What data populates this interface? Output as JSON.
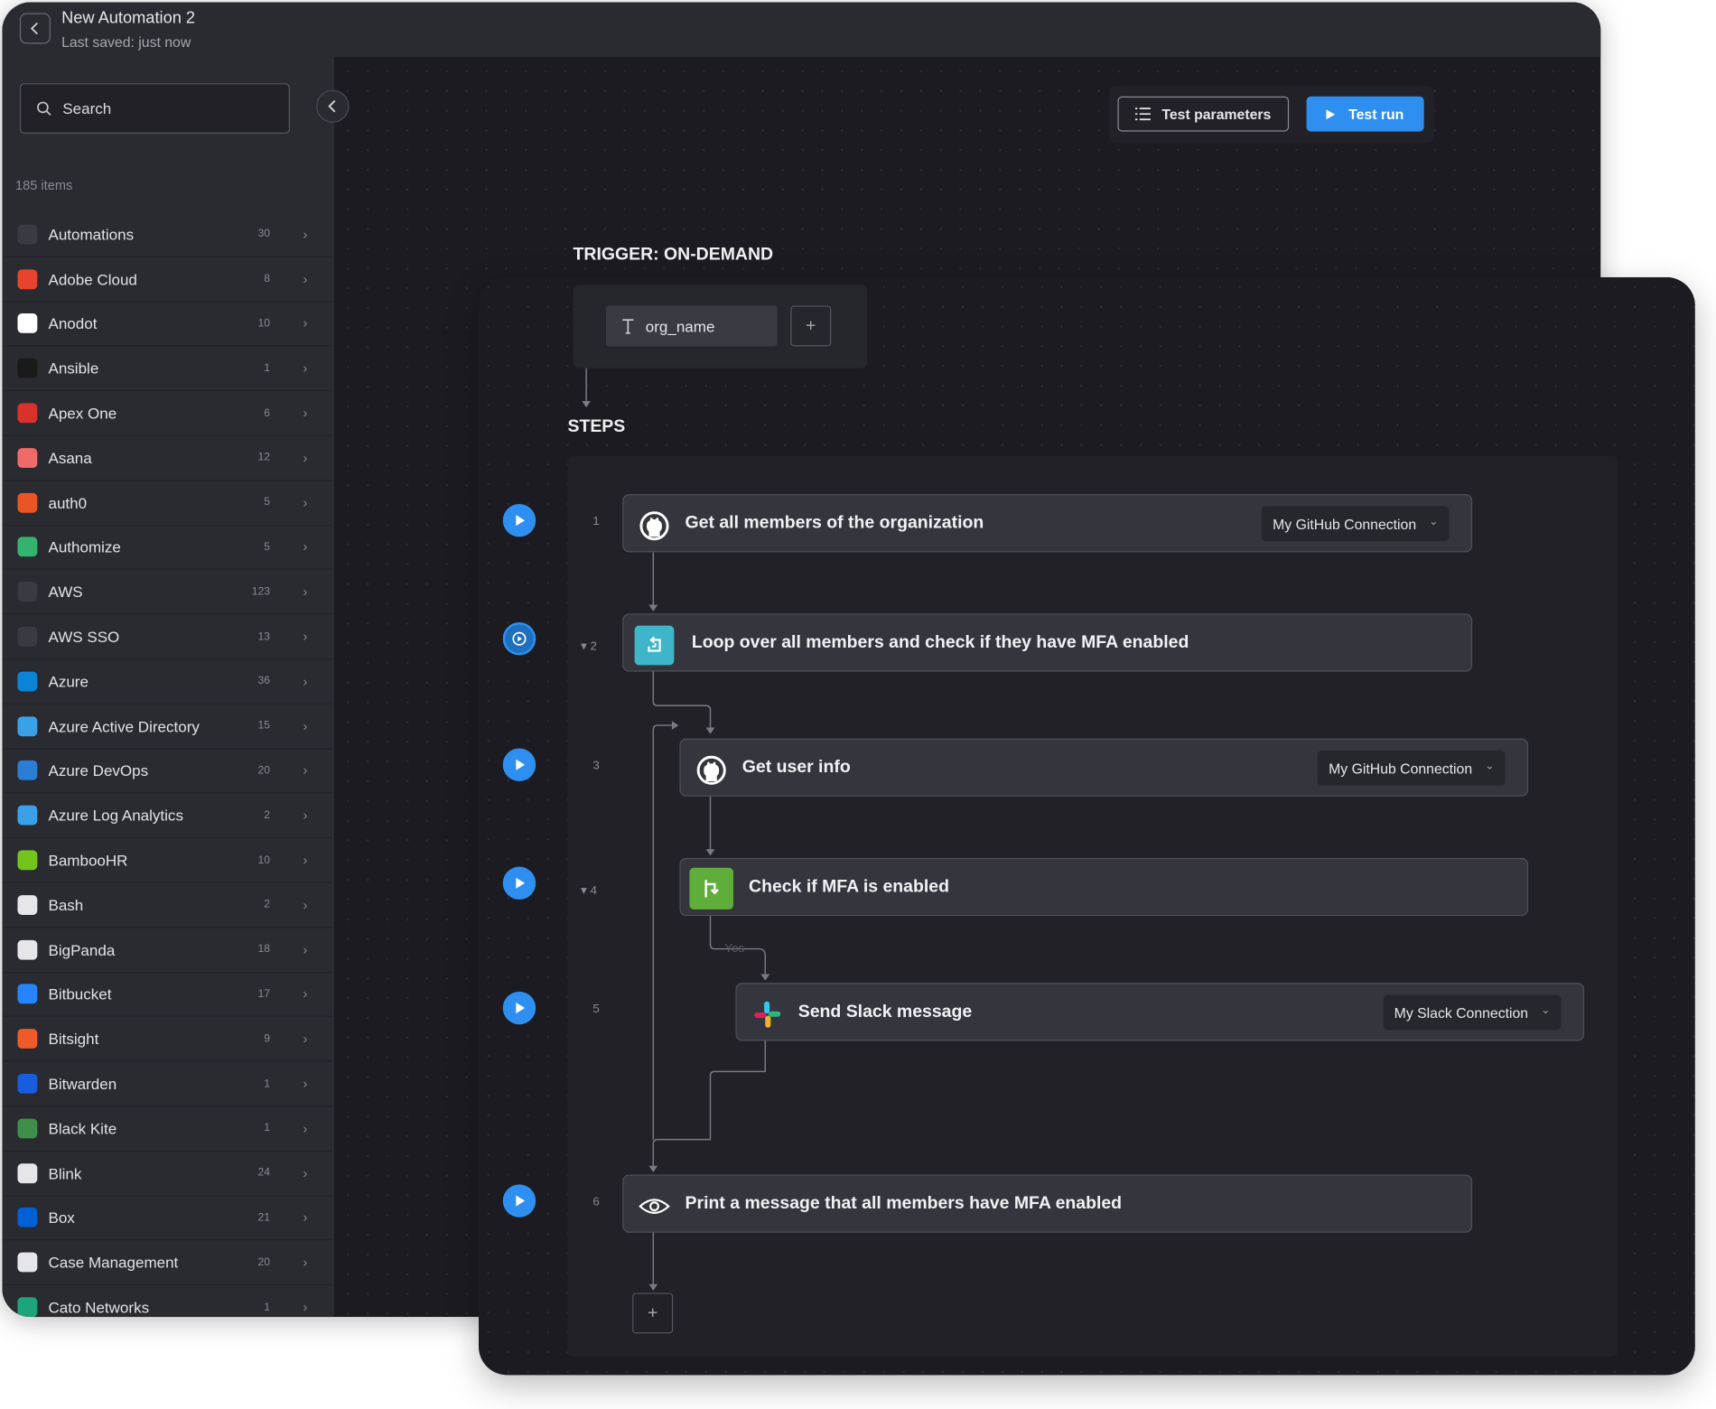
{
  "header": {
    "title": "New Automation 2",
    "subtitle": "Last saved: just now"
  },
  "sidebar": {
    "search_placeholder": "Search",
    "items_count": "185 items",
    "items": [
      {
        "label": "Automations",
        "count": "30",
        "icon": "automations-icon",
        "color": "#3a3a42"
      },
      {
        "label": "Adobe Cloud",
        "count": "8",
        "icon": "adobe-cloud-icon",
        "color": "#e8432e"
      },
      {
        "label": "Anodot",
        "count": "10",
        "icon": "anodot-icon",
        "color": "#ffffff"
      },
      {
        "label": "Ansible",
        "count": "1",
        "icon": "ansible-icon",
        "color": "#1a1a1a"
      },
      {
        "label": "Apex One",
        "count": "6",
        "icon": "apex-one-icon",
        "color": "#d8322d"
      },
      {
        "label": "Asana",
        "count": "12",
        "icon": "asana-icon",
        "color": "#f06a6a"
      },
      {
        "label": "auth0",
        "count": "5",
        "icon": "auth0-icon",
        "color": "#eb5424"
      },
      {
        "label": "Authomize",
        "count": "5",
        "icon": "authomize-icon",
        "color": "#35b36e"
      },
      {
        "label": "AWS",
        "count": "123",
        "icon": "aws-icon",
        "color": "#3a3a42"
      },
      {
        "label": "AWS SSO",
        "count": "13",
        "icon": "aws-sso-icon",
        "color": "#3a3a42"
      },
      {
        "label": "Azure",
        "count": "36",
        "icon": "azure-icon",
        "color": "#0a84d6"
      },
      {
        "label": "Azure Active Directory",
        "count": "15",
        "icon": "azure-active-directory-icon",
        "color": "#3aa0e8"
      },
      {
        "label": "Azure DevOps",
        "count": "20",
        "icon": "azure-devops-icon",
        "color": "#2b7cd3"
      },
      {
        "label": "Azure Log Analytics",
        "count": "2",
        "icon": "azure-log-analytics-icon",
        "color": "#3aa0e8"
      },
      {
        "label": "BambooHR",
        "count": "10",
        "icon": "bamboohr-icon",
        "color": "#73c41d"
      },
      {
        "label": "Bash",
        "count": "2",
        "icon": "bash-icon",
        "color": "#e6e6ea"
      },
      {
        "label": "BigPanda",
        "count": "18",
        "icon": "bigpanda-icon",
        "color": "#e6e6ea"
      },
      {
        "label": "Bitbucket",
        "count": "17",
        "icon": "bitbucket-icon",
        "color": "#2684ff"
      },
      {
        "label": "Bitsight",
        "count": "9",
        "icon": "bitsight-icon",
        "color": "#ef5a2a"
      },
      {
        "label": "Bitwarden",
        "count": "1",
        "icon": "bitwarden-icon",
        "color": "#175ddc"
      },
      {
        "label": "Black Kite",
        "count": "1",
        "icon": "black-kite-icon",
        "color": "#3f8f4a"
      },
      {
        "label": "Blink",
        "count": "24",
        "icon": "blink-icon",
        "color": "#e6e6ea"
      },
      {
        "label": "Box",
        "count": "21",
        "icon": "box-icon",
        "color": "#0061d5"
      },
      {
        "label": "Case Management",
        "count": "20",
        "icon": "case-management-icon",
        "color": "#e6e6ea"
      },
      {
        "label": "Cato Networks",
        "count": "1",
        "icon": "cato-networks-icon",
        "color": "#1fa37a"
      }
    ]
  },
  "toolbar": {
    "test_parameters": "Test parameters",
    "test_run": "Test run"
  },
  "trigger": {
    "heading": "TRIGGER: ON-DEMAND",
    "param": "org_name"
  },
  "steps_heading": "STEPS",
  "steps": [
    {
      "number": "1",
      "title": "Get all members of the organization",
      "icon": "github-icon",
      "connection": "My GitHub Connection"
    },
    {
      "number": "2",
      "title": "Loop over all members and check if they have MFA enabled",
      "icon": "loop-icon"
    },
    {
      "number": "3",
      "title": "Get user info",
      "icon": "github-icon",
      "connection": "My GitHub Connection"
    },
    {
      "number": "4",
      "title": "Check if MFA is enabled",
      "icon": "condition-icon"
    },
    {
      "number": "5",
      "title": "Send Slack message",
      "icon": "slack-icon",
      "connection": "My Slack Connection"
    },
    {
      "number": "6",
      "title": "Print a message that all members have MFA enabled",
      "icon": "eye-icon"
    }
  ],
  "branch_label": "Yes",
  "colors": {
    "accent": "#2e8ff0",
    "loop": "#3fb5c9",
    "condition": "#5fae3a"
  }
}
